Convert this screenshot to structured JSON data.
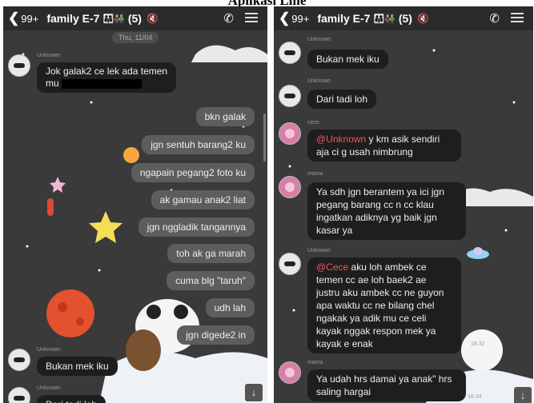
{
  "page_title": "Aplikasi Line",
  "left": {
    "header": {
      "back": "❮",
      "count": "99+",
      "title": "family E-7",
      "member_count": "(5)",
      "mute": "🔇"
    },
    "date": "Thu, 11/04",
    "messages_in": [
      {
        "sender": "Unknown",
        "line1": "Jok galak2 ce lek ada temen",
        "line2": "mu"
      },
      {
        "sender": "Unknown",
        "text": "Bukan mek iku"
      },
      {
        "sender": "Unknown",
        "text": "Dari tadi loh"
      }
    ],
    "messages_out": [
      "bkn galak",
      "jgn sentuh barang2 ku",
      "ngapain pegang2 foto ku",
      "ak gamau anak2 liat",
      "jgn nggladik tangannya",
      "toh ak ga marah",
      "cuma blg \"taruh\"",
      "udh lah",
      "jgn digede2 in"
    ]
  },
  "right": {
    "header": {
      "back": "❮",
      "count": "99+",
      "title": "family E-7",
      "member_count": "(5)",
      "mute": "🔇"
    },
    "messages": [
      {
        "sender": "Unknown",
        "text": "Bukan mek iku"
      },
      {
        "sender": "Unknown",
        "text": "Dari tadi loh"
      },
      {
        "sender": "cece",
        "mention": "@Unknown",
        "text": " y km asik sendiri aja ci g usah nimbrung"
      },
      {
        "sender": "mama",
        "text": "Ya sdh jgn berantem ya ici jgn pegang barang cc n cc klau ingatkan adiknya yg baik jgn kasar ya"
      },
      {
        "sender": "Unknown",
        "mention": "@Cece",
        "text": " aku loh ambek ce temen cc ae loh baek2 ae justru aku ambek cc ne guyon apa waktu cc ne bilang chel ngakak ya adik mu ce celi kayak nggak respon mek ya kayak e enak"
      },
      {
        "sender": "mama",
        "text": "Ya udah hrs damai ya anak\" hrs saling hargai"
      }
    ],
    "times": [
      "18.32",
      "18.34"
    ]
  },
  "icons": {
    "down": "↓"
  },
  "colors": {
    "chat_bg": "#3a3a3a",
    "header_bg": "#2b2b2b",
    "bubble_in": "#1e1e1e",
    "bubble_out": "#5d5d5d",
    "mention": "#e75a5a"
  }
}
